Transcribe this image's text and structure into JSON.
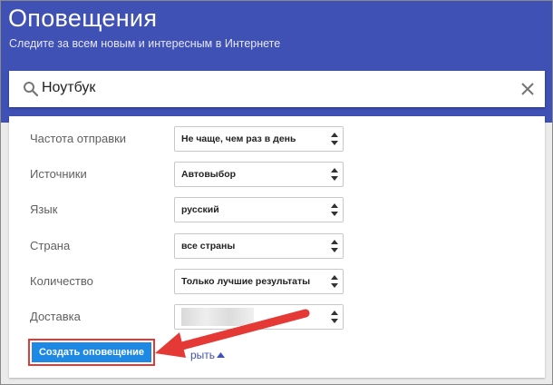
{
  "header": {
    "title": "Оповещения",
    "subtitle": "Следите за всем новым и интересным в Интернете"
  },
  "search": {
    "value": "Ноутбук",
    "icon": "search-icon",
    "clear_icon": "close-icon"
  },
  "options": [
    {
      "label": "Частота отправки",
      "value": "Не чаще, чем раз в день"
    },
    {
      "label": "Источники",
      "value": "Автовыбор"
    },
    {
      "label": "Язык",
      "value": "русский"
    },
    {
      "label": "Страна",
      "value": "все страны"
    },
    {
      "label": "Количество",
      "value": "Только лучшие результаты"
    },
    {
      "label": "Доставка",
      "value": ""
    }
  ],
  "actions": {
    "create_label": "Создать оповещение",
    "hide_label": "рыть"
  },
  "colors": {
    "header_bg": "#3f51b5",
    "button_bg": "#1e88e5",
    "annotation_red": "#e53935"
  }
}
